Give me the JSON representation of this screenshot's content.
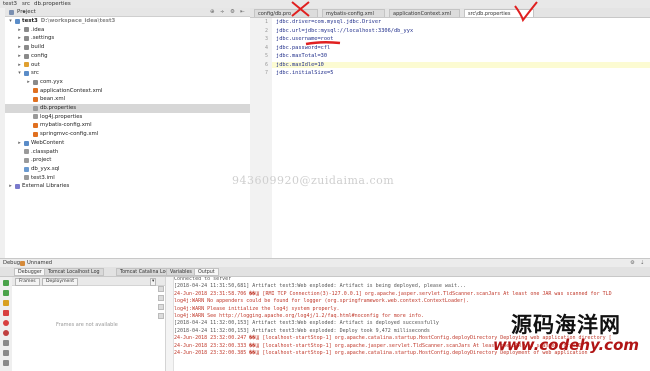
{
  "title_bar": {
    "project": "test3",
    "breadcrumb_sep": "src",
    "file": "db.properties"
  },
  "project_panel": {
    "header_label": "Project",
    "tree": [
      {
        "label": "test3",
        "dim": "D:\\workspace_idea\\test3",
        "depth": 0,
        "arrow": "down",
        "icon": "#5a8cc8",
        "bold": true
      },
      {
        "label": ".idea",
        "depth": 1,
        "arrow": "right",
        "icon": "#8a8a8a"
      },
      {
        "label": ".settings",
        "depth": 1,
        "arrow": "right",
        "icon": "#8a8a8a"
      },
      {
        "label": "build",
        "depth": 1,
        "arrow": "right",
        "icon": "#8a8a8a"
      },
      {
        "label": "config",
        "depth": 1,
        "arrow": "right",
        "icon": "#8a8a8a"
      },
      {
        "label": "out",
        "depth": 1,
        "arrow": "right",
        "icon": "#e0a030"
      },
      {
        "label": "src",
        "depth": 1,
        "arrow": "down",
        "icon": "#5a8cc8"
      },
      {
        "label": "com.yyx",
        "depth": 2,
        "arrow": "right",
        "icon": "#8a8a8a"
      },
      {
        "label": "applicationContext.xml",
        "depth": 2,
        "arrow": "",
        "icon": "#e07020"
      },
      {
        "label": "bean.xml",
        "depth": 2,
        "arrow": "",
        "icon": "#e07020"
      },
      {
        "label": "db.properties",
        "depth": 2,
        "arrow": "",
        "icon": "#9a9a9a",
        "selected": true
      },
      {
        "label": "log4j.properties",
        "depth": 2,
        "arrow": "",
        "icon": "#9a9a9a"
      },
      {
        "label": "mybatis-config.xml",
        "depth": 2,
        "arrow": "",
        "icon": "#e07020"
      },
      {
        "label": "springmvc-config.xml",
        "depth": 2,
        "arrow": "",
        "icon": "#e07020"
      },
      {
        "label": "WebContent",
        "depth": 1,
        "arrow": "right",
        "icon": "#5a8cc8"
      },
      {
        "label": ".classpath",
        "depth": 1,
        "arrow": "",
        "icon": "#9a9a9a"
      },
      {
        "label": ".project",
        "depth": 1,
        "arrow": "",
        "icon": "#9a9a9a"
      },
      {
        "label": "db_yyx.sql",
        "depth": 1,
        "arrow": "",
        "icon": "#6a9ad0"
      },
      {
        "label": "test3.iml",
        "depth": 1,
        "arrow": "",
        "icon": "#9a9a9a"
      },
      {
        "label": "External Libraries",
        "depth": 0,
        "arrow": "right",
        "icon": "#7a7acc"
      }
    ]
  },
  "editor_tabs": [
    {
      "label": "config/db.pro",
      "active": false
    },
    {
      "label": "mybatis-config.xml",
      "active": false
    },
    {
      "label": "applicationContext.xml",
      "active": false
    },
    {
      "label": "src\\db.properties",
      "active": true
    }
  ],
  "editor_lines": [
    "jdbc.driver=com.mysql.jdbc.Driver",
    "jdbc.url=jdbc:mysql://localhost:3306/db_yyx",
    "jdbc.username=root",
    "jdbc.password=cfl",
    "jdbc.maxTotal=30",
    "jdbc.maxIdle=10",
    "jdbc.initialSize=5"
  ],
  "highlighted_line": 6,
  "watermark_text": "943609920@zuidaima.com",
  "debug_bar": {
    "label": "Debug",
    "config": "Unnamed"
  },
  "debug_tabs": [
    {
      "label": "Debugger",
      "active": true
    },
    {
      "label": "Tomcat Localhost Log",
      "active": false
    },
    {
      "label": "Tomcat Catalina Log",
      "active": false
    }
  ],
  "frames": {
    "tab1": "Frames",
    "tab2": "Deployment",
    "empty_message": "Frames are not available"
  },
  "variables_tabs": {
    "variables": "Variables",
    "output": "Output"
  },
  "console_lines": [
    {
      "text": "Connected to server",
      "style": "grey"
    },
    {
      "text": "[2018-04-24 11:31:50,681] Artifact test3:Web exploded: Artifact is being deployed, please wait...",
      "style": "grey"
    },
    {
      "text": "24-Jun-2018 23:31:58.706 ��Ϣ [RMI TCP Connection(3)-127.0.0.1] org.apache.jasper.servlet.TldScanner.scanJars At least one JAR was scanned for TLD",
      "style": "red"
    },
    {
      "text": "log4j:WARN No appenders could be found for logger (org.springframework.web.context.ContextLoader).",
      "style": "red"
    },
    {
      "text": "log4j:WARN Please initialize the log4j system properly.",
      "style": "red"
    },
    {
      "text": "log4j:WARN See http://logging.apache.org/log4j/1.2/faq.html#noconfig for more info.",
      "style": "red"
    },
    {
      "text": "[2018-04-24 11:32:00,153] Artifact test3:Web exploded: Artifact is deployed successfully",
      "style": "grey"
    },
    {
      "text": "[2018-04-24 11:32:00,153] Artifact test3:Web exploded: Deploy took 9,472 milliseconds",
      "style": "grey"
    },
    {
      "text": "24-Jun-2018 23:32:00.247 ��Ϣ [localhost-startStop-1] org.apache.catalina.startup.HostConfig.deployDirectory Deploying web application directory [",
      "style": "red"
    },
    {
      "text": "24-Jun-2018 23:32:00.333 ��Ϣ [localhost-startStop-1] org.apache.jasper.servlet.TldScanner.scanJars At least one JAR was scanned for TLD",
      "style": "red"
    },
    {
      "text": "24-Jun-2018 23:32:00.385 ��Ϣ [localhost-startStop-1] org.apache.catalina.startup.HostConfig.deployDirectory Deployment of web application",
      "style": "red"
    }
  ],
  "brand": {
    "chinese": "源码海洋网",
    "url": "www.codehy.com"
  }
}
